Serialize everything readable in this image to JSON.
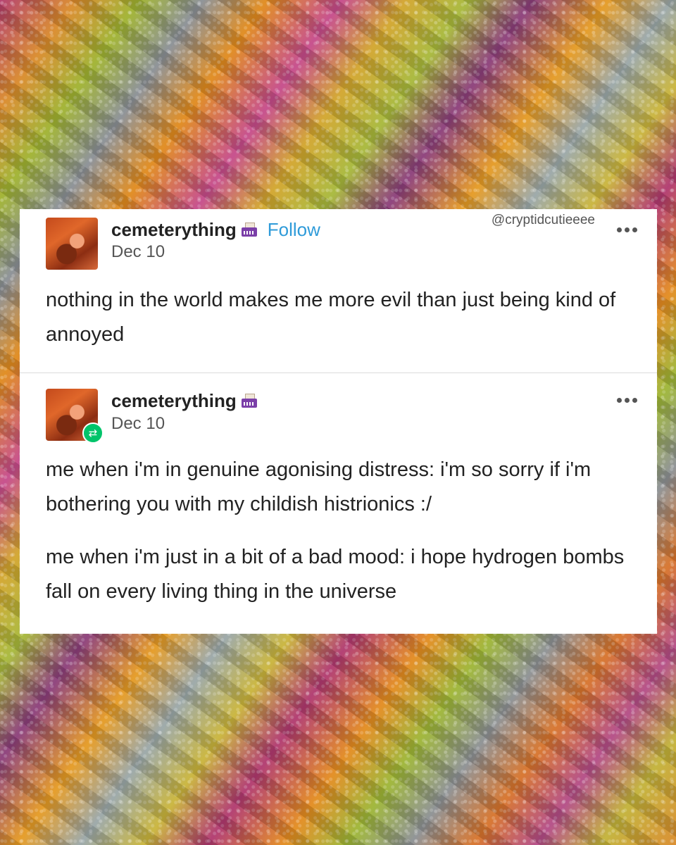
{
  "watermark": "@cryptidcutieeee",
  "posts": [
    {
      "username": "cemeterything",
      "follow_label": "Follow",
      "date": "Dec 10",
      "paragraphs": [
        "nothing in the world makes me more evil than just being kind of annoyed"
      ]
    },
    {
      "username": "cemeterything",
      "date": "Dec 10",
      "paragraphs": [
        "me when i'm in genuine agonising distress: i'm so sorry if i'm bothering you with my childish histrionics :/",
        "me when i'm just in a bit of a bad mood: i hope hydrogen bombs fall on every living thing in the universe"
      ]
    }
  ],
  "icons": {
    "blog_badge": "typewriter-icon",
    "menu": "more-icon",
    "reblog": "reblog-icon"
  },
  "colors": {
    "follow": "#2f9bd9",
    "reblog_badge": "#00c46a",
    "text": "#222222"
  }
}
